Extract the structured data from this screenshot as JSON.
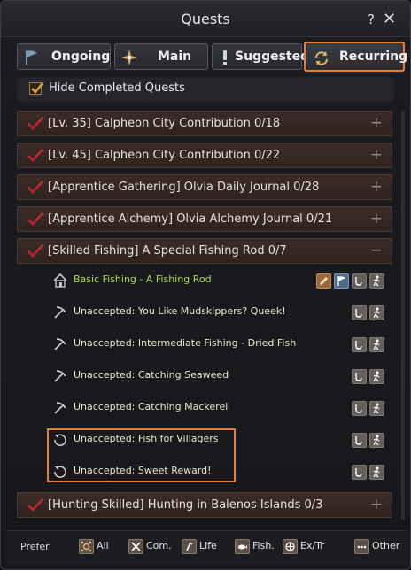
{
  "window": {
    "title": "Quests",
    "help_label": "?",
    "close_label": "✕"
  },
  "tabs": [
    {
      "label": "Ongoing",
      "icon": "flag-icon"
    },
    {
      "label": "Main",
      "icon": "compass-star-icon"
    },
    {
      "label": "Suggested",
      "icon": "exclamation-icon"
    },
    {
      "label": "Recurring",
      "icon": "recurring-arrows-icon",
      "active": true
    }
  ],
  "hide_completed": {
    "label": "Hide Completed Quests",
    "checked": true
  },
  "quests": [
    {
      "title": "[Lv. 35] Calpheon City Contribution 0/18",
      "toggle": "+"
    },
    {
      "title": "[Lv. 45] Calpheon City Contribution 0/22",
      "toggle": "+"
    },
    {
      "title": "[Apprentice Gathering] Olvia Daily Journal 0/28",
      "toggle": "+"
    },
    {
      "title": "[Apprentice Alchemy] Olvia Alchemy Journal 0/21",
      "toggle": "+"
    },
    {
      "title": "[Skilled Fishing] A Special Fishing Rod 0/7",
      "toggle": "−"
    },
    {
      "title": "[Hunting Skilled] Hunting in Balenos Islands 0/3",
      "toggle": "+"
    }
  ],
  "subquests": [
    {
      "title": "Basic Fishing - A Fishing Rod",
      "icon": "house-icon",
      "status": "in-progress"
    },
    {
      "title": "Unaccepted: You Like Mudskippers? Queek!",
      "icon": "pickaxe-icon",
      "status": "unaccepted"
    },
    {
      "title": "Unaccepted: Intermediate Fishing - Dried Fish",
      "icon": "pickaxe-icon",
      "status": "unaccepted"
    },
    {
      "title": "Unaccepted: Catching Seaweed",
      "icon": "pickaxe-icon",
      "status": "unaccepted"
    },
    {
      "title": "Unaccepted: Catching Mackerel",
      "icon": "pickaxe-icon",
      "status": "unaccepted"
    },
    {
      "title": "Unaccepted: Fish for Villagers",
      "icon": "repeat-icon",
      "status": "unaccepted"
    },
    {
      "title": "Unaccepted: Sweet Reward!",
      "icon": "repeat-icon",
      "status": "unaccepted"
    }
  ],
  "footer": {
    "prefer_label": "Prefer",
    "filters": [
      {
        "label": "All",
        "icon": "all-icon"
      },
      {
        "label": "Com.",
        "icon": "combat-icon"
      },
      {
        "label": "Life",
        "icon": "life-icon"
      },
      {
        "label": "Fish.",
        "icon": "fishing-icon"
      },
      {
        "label": "Ex/Tr",
        "icon": "explore-trade-icon"
      },
      {
        "label": "Other",
        "icon": "other-icon"
      }
    ]
  },
  "colors": {
    "accent": "#e8812e",
    "quest_row": "#3c2c27",
    "check": "#c3242e",
    "green_text": "#b9d64a",
    "text": "#e7e2dc"
  }
}
